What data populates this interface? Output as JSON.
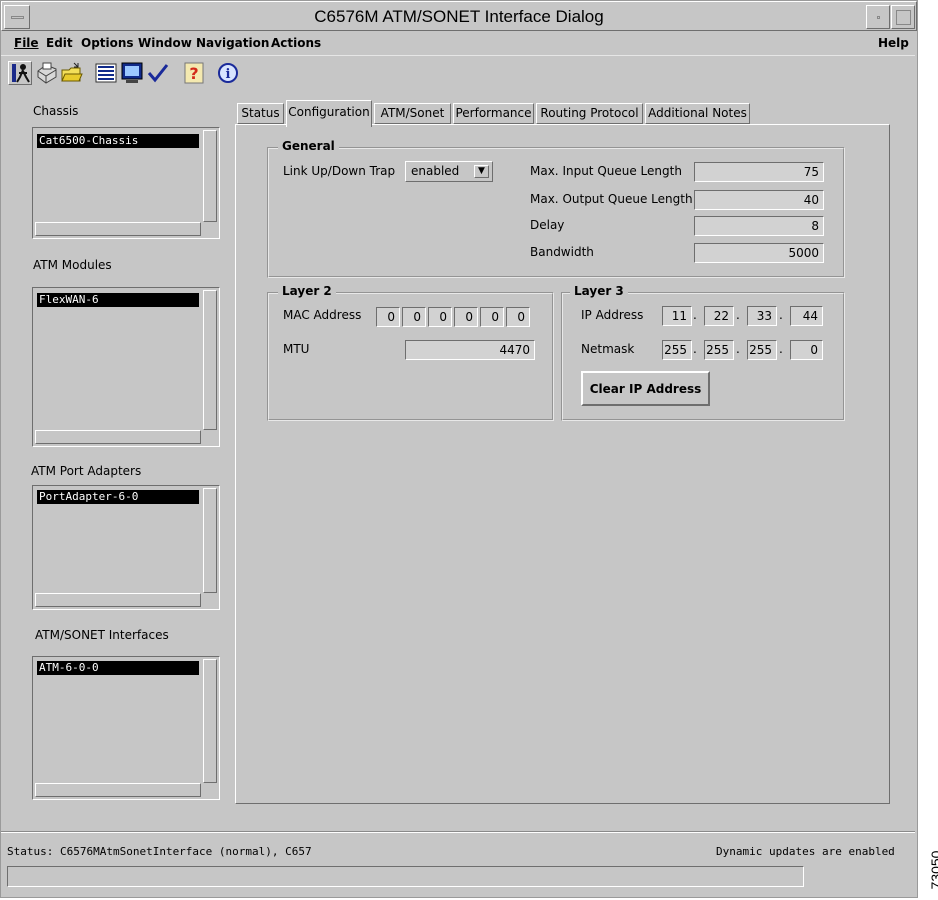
{
  "window": {
    "title": "C6576M ATM/SONET Interface Dialog"
  },
  "menu": {
    "items": [
      "File",
      "Edit",
      "Options",
      "Window",
      "Navigation",
      "Actions"
    ],
    "help": "Help"
  },
  "toolbar": {
    "icons": [
      "run-icon",
      "print-icon",
      "open-folder-icon",
      "list-icon",
      "monitor-icon",
      "checkmark-icon",
      "help-question-icon",
      "info-icon"
    ]
  },
  "left": {
    "chassis": {
      "label": "Chassis",
      "selected": "Cat6500-Chassis"
    },
    "modules": {
      "label": "ATM Modules",
      "selected": "FlexWAN-6"
    },
    "adapters": {
      "label": "ATM Port Adapters",
      "selected": "PortAdapter-6-0"
    },
    "interfaces": {
      "label": "ATM/SONET Interfaces",
      "selected": "ATM-6-0-0"
    }
  },
  "tabs": [
    "Status",
    "Configuration",
    "ATM/Sonet",
    "Performance",
    "Routing Protocol",
    "Additional Notes"
  ],
  "active_tab": "Configuration",
  "general": {
    "title": "General",
    "trap_label": "Link Up/Down Trap",
    "trap_value": "enabled",
    "in_q_label": "Max. Input Queue Length",
    "in_q": "75",
    "out_q_label": "Max. Output Queue Length",
    "out_q": "40",
    "delay_label": "Delay",
    "delay": "8",
    "bw_label": "Bandwidth",
    "bw": "5000"
  },
  "layer2": {
    "title": "Layer 2",
    "mac_label": "MAC Address",
    "mac": [
      "0",
      "0",
      "0",
      "0",
      "0",
      "0"
    ],
    "mtu_label": "MTU",
    "mtu": "4470"
  },
  "layer3": {
    "title": "Layer 3",
    "ip_label": "IP Address",
    "ip": [
      "11",
      "22",
      "33",
      "44"
    ],
    "mask_label": "Netmask",
    "mask": [
      "255",
      "255",
      "255",
      "0"
    ],
    "clear_button": "Clear IP Address"
  },
  "status": {
    "left": "Status: C6576MAtmSonetInterface (normal), C657",
    "right": "Dynamic updates are enabled"
  },
  "side_label": "73050"
}
